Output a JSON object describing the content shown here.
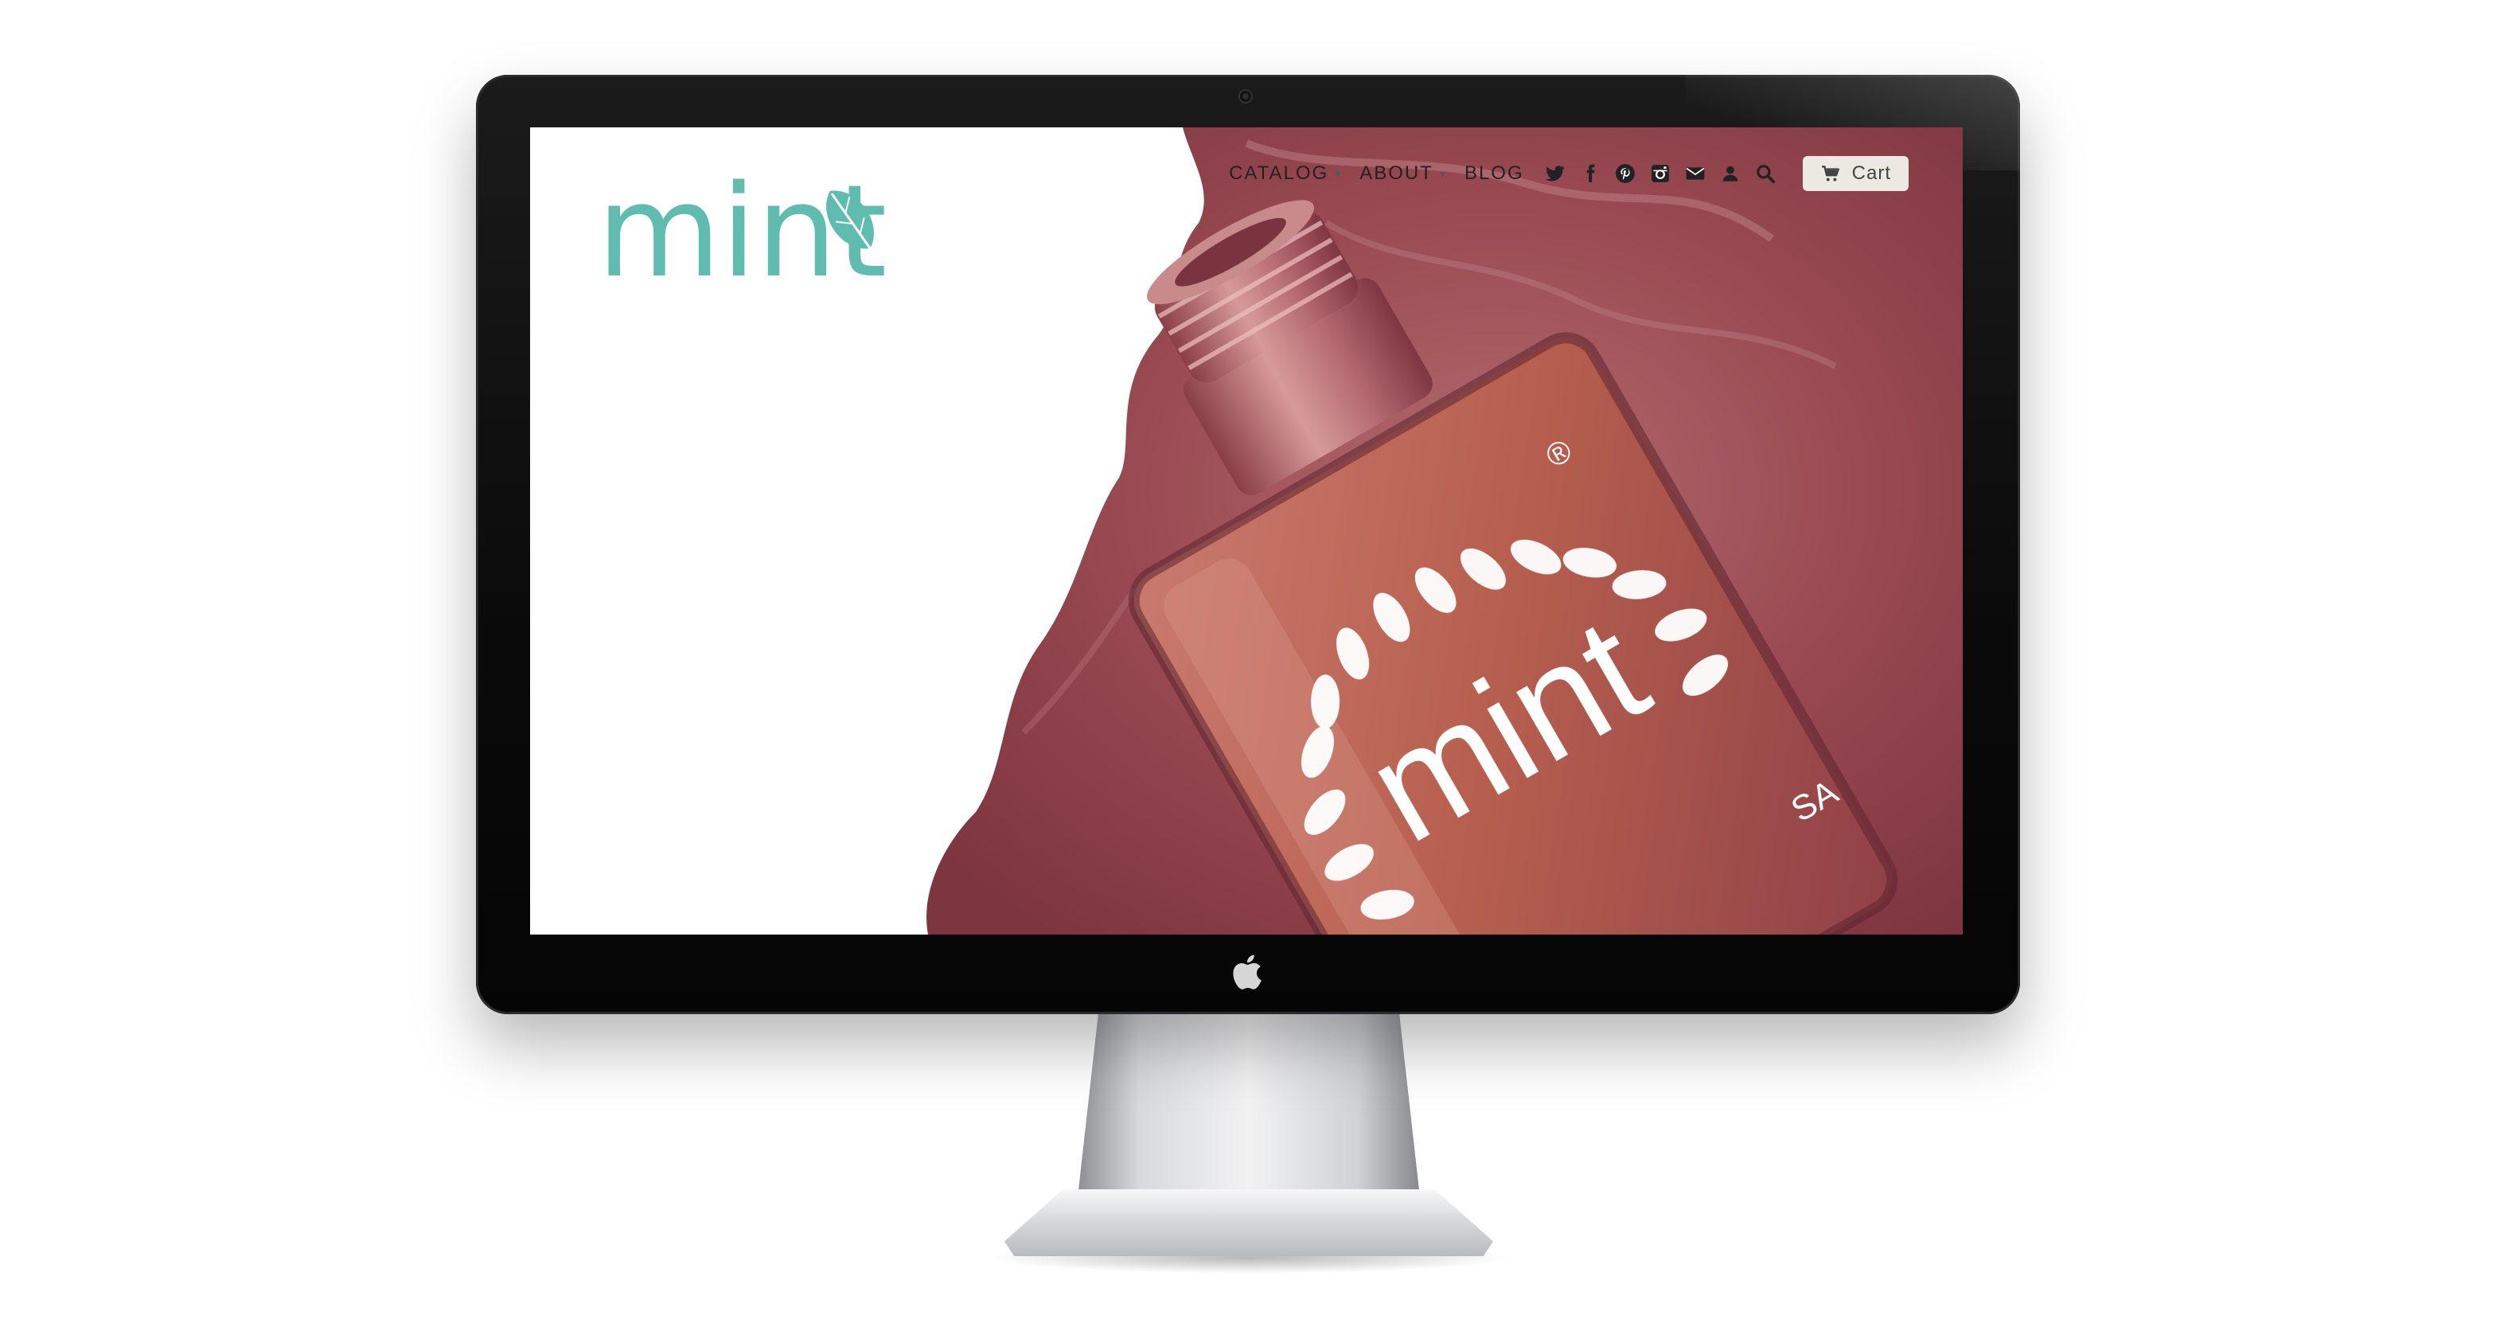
{
  "brand": {
    "name": "mint",
    "accent_color": "#5fbcae",
    "logo_icon": "leaf-icon"
  },
  "nav": {
    "items": [
      {
        "label": "CATALOG",
        "has_dropdown": true
      },
      {
        "label": "ABOUT",
        "has_dropdown": true
      },
      {
        "label": "BLOG",
        "has_dropdown": false
      }
    ],
    "social_icons": [
      "twitter-icon",
      "facebook-icon",
      "pinterest-icon",
      "instagram-icon",
      "mail-icon",
      "user-icon",
      "search-icon"
    ],
    "cart": {
      "label": "Cart",
      "icon": "cart-icon"
    }
  },
  "hero": {
    "bottle_label": "mint",
    "bottle_mark": "®",
    "bottle_partial_text": "SA",
    "polish_color": "#9a4a52",
    "bottle_color": "#b86a62"
  },
  "device": {
    "brand_icon": "apple-icon"
  }
}
